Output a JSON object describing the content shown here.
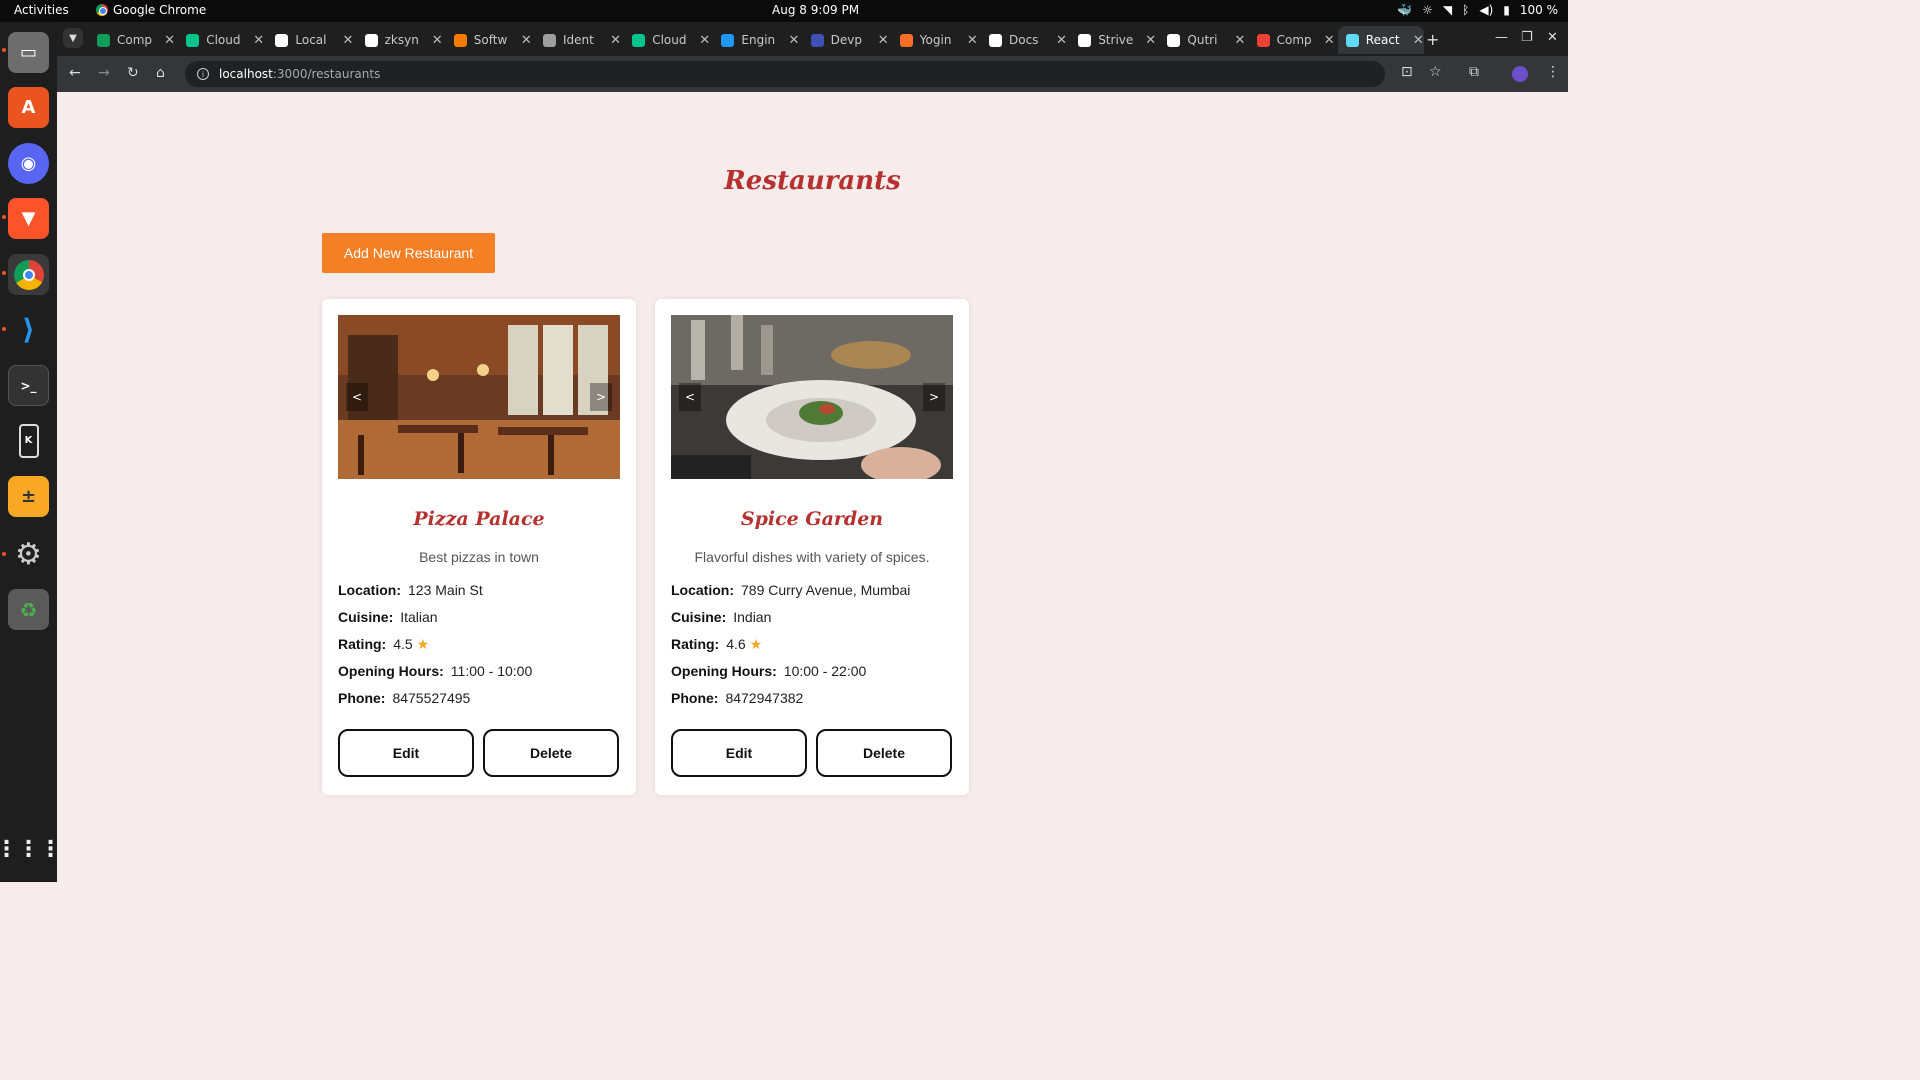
{
  "system": {
    "activities": "Activities",
    "app_name": "Google Chrome",
    "clock": "Aug 8  9:09 PM",
    "battery": "100 %"
  },
  "tabs": [
    {
      "label": "Comp",
      "color": "#0f9d58"
    },
    {
      "label": "Cloud",
      "color": "#00c48c"
    },
    {
      "label": "Local",
      "color": "#ffffff"
    },
    {
      "label": "zksyn",
      "color": "#ffffff"
    },
    {
      "label": "Softw",
      "color": "#f57c00"
    },
    {
      "label": "Ident",
      "color": "#9e9e9e"
    },
    {
      "label": "Cloud",
      "color": "#00c48c"
    },
    {
      "label": "Engin",
      "color": "#2196f3"
    },
    {
      "label": "Devp",
      "color": "#3f51b5"
    },
    {
      "label": "Yogin",
      "color": "#fc6d26"
    },
    {
      "label": "Docs",
      "color": "#ffffff"
    },
    {
      "label": "Strive",
      "color": "#ffffff"
    },
    {
      "label": "Qutri",
      "color": "#ffffff"
    },
    {
      "label": "Comp",
      "color": "#ea4335"
    },
    {
      "label": "React",
      "color": "#61dafb",
      "active": true
    }
  ],
  "address": {
    "host": "localhost",
    "path": ":3000/restaurants"
  },
  "page": {
    "title": "Restaurants",
    "add_button": "Add New Restaurant"
  },
  "restaurants": [
    {
      "name": "Pizza Palace",
      "description": "Best pizzas in town",
      "location_label": "Location:",
      "location": "123 Main St",
      "cuisine_label": "Cuisine:",
      "cuisine": "Italian",
      "rating_label": "Rating:",
      "rating": "4.5",
      "hours_label": "Opening Hours:",
      "hours": "11:00 - 10:00",
      "phone_label": "Phone:",
      "phone": "8475527495",
      "edit": "Edit",
      "delete": "Delete",
      "prev": "<",
      "next": ">"
    },
    {
      "name": "Spice Garden",
      "description": "Flavorful dishes with variety of spices.",
      "location_label": "Location:",
      "location": "789 Curry Avenue, Mumbai",
      "cuisine_label": "Cuisine:",
      "cuisine": "Indian",
      "rating_label": "Rating:",
      "rating": "4.6",
      "hours_label": "Opening Hours:",
      "hours": "10:00 - 22:00",
      "phone_label": "Phone:",
      "phone": "8472947382",
      "edit": "Edit",
      "delete": "Delete",
      "prev": "<",
      "next": ">"
    }
  ],
  "colors": {
    "accent": "#f57f24",
    "title_red": "#b5302e",
    "page_bg": "#f5eceb"
  }
}
